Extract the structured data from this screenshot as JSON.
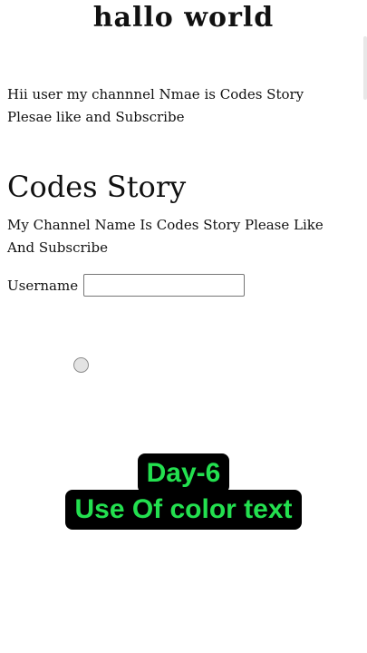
{
  "page": {
    "title": "hallo world"
  },
  "intro": {
    "line1": "Hii user my channnel Nmae is Codes Story",
    "line2": "Plesae like and Subscribe"
  },
  "heading": "Codes Story",
  "description": "My Channel Name Is Codes Story  Please Like And Subscribe",
  "form": {
    "username_label": "Username",
    "username_value": "",
    "username_placeholder": ""
  },
  "overlay": {
    "day": "Day-6",
    "topic": "Use Of color text",
    "text_color": "#23e04f",
    "background_color": "#000000"
  }
}
